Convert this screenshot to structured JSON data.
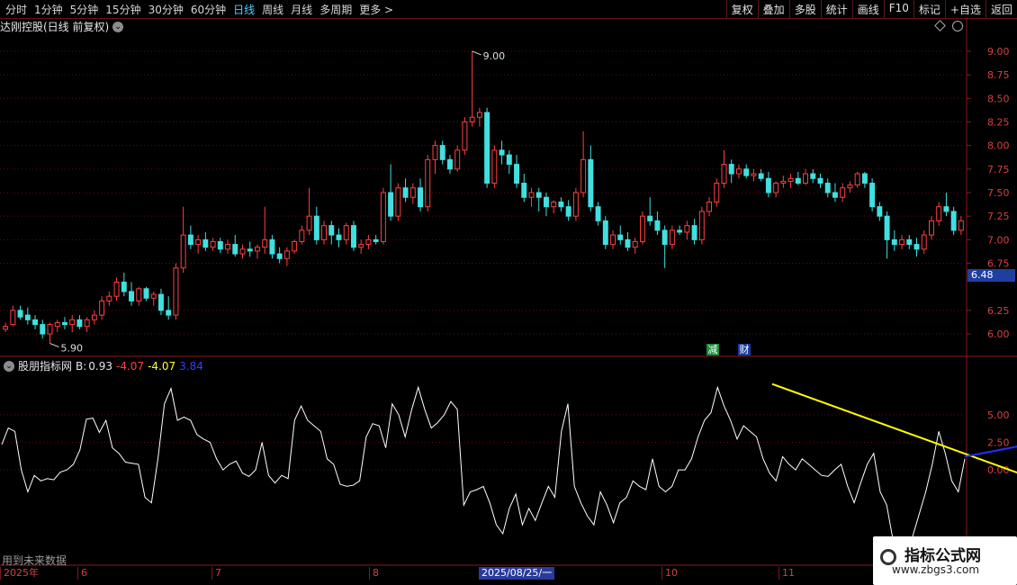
{
  "toolbar": {
    "timeframes": [
      "分时",
      "1分钟",
      "5分钟",
      "15分钟",
      "30分钟",
      "60分钟",
      "日线",
      "周线",
      "月线",
      "多周期",
      "更多 >"
    ],
    "active": "日线",
    "right_buttons": [
      "复权",
      "叠加",
      "多股",
      "统计",
      "画线",
      "F10",
      "标记",
      "+自选",
      "返回"
    ]
  },
  "chart_title": "达刚控股(日线 前复权)",
  "price_axis": [
    "9.00",
    "8.75",
    "8.50",
    "8.25",
    "8.00",
    "7.75",
    "7.50",
    "7.25",
    "7.00",
    "6.75",
    "6.25",
    "6.00"
  ],
  "current_price": "6.48",
  "high_label": "9.00",
  "low_label": "5.90",
  "badges": {
    "reduce": "减",
    "finance": "财"
  },
  "indicator": {
    "name": "股朋指标网",
    "b_label": "B:",
    "b_value": "0.93",
    "v2": "-4.07",
    "v3": "-4.07",
    "v4": "3.84",
    "axis": [
      "5.00",
      "2.50",
      "0.00"
    ]
  },
  "footer_note": "用到未来数据",
  "date_axis": {
    "ticks": [
      "2025年",
      "6",
      "7",
      "8",
      "10",
      "11"
    ],
    "highlight": "2025/08/25/一"
  },
  "logo": {
    "main": "指标公式网",
    "sub": "www.zbgs3.com"
  },
  "colors": {
    "up": "#ff4040",
    "down": "#40e0e0",
    "grid": "#5a1010",
    "line1": "#ffffff",
    "yellow": "#ffff00",
    "blue": "#2030ff"
  },
  "chart_data": {
    "type": "candlestick",
    "ohlc": [
      [
        6.05,
        6.12,
        6.02,
        6.08
      ],
      [
        6.1,
        6.3,
        6.08,
        6.25
      ],
      [
        6.25,
        6.3,
        6.15,
        6.18
      ],
      [
        6.2,
        6.28,
        6.1,
        6.15
      ],
      [
        6.15,
        6.2,
        6.05,
        6.1
      ],
      [
        6.1,
        6.15,
        5.95,
        6.0
      ],
      [
        6.0,
        6.12,
        5.9,
        6.1
      ],
      [
        6.08,
        6.15,
        6.02,
        6.12
      ],
      [
        6.12,
        6.18,
        6.05,
        6.1
      ],
      [
        6.1,
        6.2,
        6.02,
        6.15
      ],
      [
        6.15,
        6.2,
        6.05,
        6.08
      ],
      [
        6.08,
        6.18,
        6.02,
        6.15
      ],
      [
        6.15,
        6.25,
        6.1,
        6.2
      ],
      [
        6.2,
        6.4,
        6.15,
        6.35
      ],
      [
        6.35,
        6.45,
        6.3,
        6.4
      ],
      [
        6.4,
        6.6,
        6.35,
        6.55
      ],
      [
        6.55,
        6.65,
        6.4,
        6.45
      ],
      [
        6.45,
        6.55,
        6.3,
        6.35
      ],
      [
        6.35,
        6.5,
        6.3,
        6.48
      ],
      [
        6.48,
        6.5,
        6.35,
        6.38
      ],
      [
        6.38,
        6.45,
        6.3,
        6.42
      ],
      [
        6.42,
        6.48,
        6.2,
        6.25
      ],
      [
        6.25,
        6.4,
        6.15,
        6.2
      ],
      [
        6.2,
        6.75,
        6.15,
        6.7
      ],
      [
        6.7,
        7.35,
        6.65,
        7.05
      ],
      [
        7.05,
        7.15,
        6.9,
        6.95
      ],
      [
        6.95,
        7.05,
        6.85,
        7.0
      ],
      [
        7.0,
        7.08,
        6.88,
        6.92
      ],
      [
        6.92,
        7.02,
        6.88,
        6.98
      ],
      [
        6.98,
        7.02,
        6.86,
        6.9
      ],
      [
        6.9,
        7.0,
        6.85,
        6.95
      ],
      [
        6.95,
        7.05,
        6.82,
        6.85
      ],
      [
        6.85,
        6.95,
        6.8,
        6.9
      ],
      [
        6.9,
        6.98,
        6.82,
        6.88
      ],
      [
        6.88,
        6.95,
        6.8,
        6.92
      ],
      [
        6.92,
        7.35,
        6.85,
        7.0
      ],
      [
        7.0,
        7.05,
        6.8,
        6.85
      ],
      [
        6.85,
        6.92,
        6.75,
        6.8
      ],
      [
        6.8,
        6.92,
        6.72,
        6.88
      ],
      [
        6.88,
        7.0,
        6.85,
        6.98
      ],
      [
        6.98,
        7.15,
        6.95,
        7.1
      ],
      [
        7.1,
        7.55,
        7.05,
        7.25
      ],
      [
        7.25,
        7.35,
        6.95,
        7.0
      ],
      [
        7.0,
        7.2,
        6.95,
        7.15
      ],
      [
        7.15,
        7.2,
        6.95,
        7.05
      ],
      [
        7.05,
        7.12,
        6.92,
        7.0
      ],
      [
        7.0,
        7.18,
        6.95,
        7.15
      ],
      [
        7.15,
        7.2,
        6.88,
        6.92
      ],
      [
        6.92,
        7.0,
        6.85,
        6.95
      ],
      [
        6.95,
        7.05,
        6.9,
        7.0
      ],
      [
        7.0,
        7.05,
        6.95,
        6.98
      ],
      [
        6.98,
        7.55,
        6.95,
        7.5
      ],
      [
        7.5,
        7.8,
        7.2,
        7.25
      ],
      [
        7.25,
        7.6,
        7.2,
        7.55
      ],
      [
        7.55,
        7.65,
        7.4,
        7.45
      ],
      [
        7.45,
        7.6,
        7.38,
        7.55
      ],
      [
        7.55,
        7.65,
        7.3,
        7.35
      ],
      [
        7.35,
        7.9,
        7.3,
        7.85
      ],
      [
        7.85,
        8.05,
        7.7,
        8.0
      ],
      [
        8.0,
        8.05,
        7.8,
        7.85
      ],
      [
        7.85,
        7.9,
        7.7,
        7.75
      ],
      [
        7.75,
        8.0,
        7.72,
        7.95
      ],
      [
        7.95,
        8.3,
        7.9,
        8.25
      ],
      [
        8.25,
        9.0,
        8.2,
        8.3
      ],
      [
        8.3,
        8.4,
        8.2,
        8.35
      ],
      [
        8.35,
        8.4,
        7.55,
        7.6
      ],
      [
        7.6,
        8.0,
        7.55,
        7.95
      ],
      [
        7.95,
        8.05,
        7.8,
        7.9
      ],
      [
        7.9,
        7.95,
        7.7,
        7.8
      ],
      [
        7.8,
        7.9,
        7.55,
        7.6
      ],
      [
        7.6,
        7.7,
        7.4,
        7.45
      ],
      [
        7.45,
        7.55,
        7.35,
        7.5
      ],
      [
        7.5,
        7.55,
        7.3,
        7.45
      ],
      [
        7.45,
        7.5,
        7.25,
        7.35
      ],
      [
        7.35,
        7.42,
        7.28,
        7.4
      ],
      [
        7.4,
        7.45,
        7.3,
        7.35
      ],
      [
        7.35,
        7.42,
        7.2,
        7.25
      ],
      [
        7.25,
        7.55,
        7.2,
        7.5
      ],
      [
        7.5,
        8.15,
        7.45,
        7.85
      ],
      [
        7.85,
        8.0,
        7.3,
        7.35
      ],
      [
        7.35,
        7.4,
        7.15,
        7.2
      ],
      [
        7.2,
        7.25,
        6.9,
        6.95
      ],
      [
        6.95,
        7.1,
        6.9,
        7.05
      ],
      [
        7.05,
        7.15,
        6.95,
        7.0
      ],
      [
        7.0,
        7.08,
        6.88,
        6.92
      ],
      [
        6.92,
        7.02,
        6.85,
        6.98
      ],
      [
        6.98,
        7.3,
        6.95,
        7.25
      ],
      [
        7.25,
        7.45,
        7.15,
        7.2
      ],
      [
        7.2,
        7.3,
        7.05,
        7.1
      ],
      [
        7.1,
        7.15,
        6.7,
        6.95
      ],
      [
        6.95,
        7.15,
        6.9,
        7.1
      ],
      [
        7.1,
        7.15,
        7.05,
        7.08
      ],
      [
        7.08,
        7.2,
        7.0,
        7.15
      ],
      [
        7.15,
        7.22,
        6.95,
        7.0
      ],
      [
        7.0,
        7.35,
        6.95,
        7.3
      ],
      [
        7.3,
        7.45,
        7.25,
        7.4
      ],
      [
        7.4,
        7.65,
        7.35,
        7.6
      ],
      [
        7.6,
        7.95,
        7.55,
        7.8
      ],
      [
        7.8,
        7.85,
        7.6,
        7.7
      ],
      [
        7.7,
        7.8,
        7.65,
        7.75
      ],
      [
        7.75,
        7.8,
        7.65,
        7.68
      ],
      [
        7.68,
        7.75,
        7.62,
        7.7
      ],
      [
        7.7,
        7.75,
        7.62,
        7.65
      ],
      [
        7.65,
        7.72,
        7.45,
        7.5
      ],
      [
        7.5,
        7.62,
        7.45,
        7.6
      ],
      [
        7.6,
        7.68,
        7.55,
        7.62
      ],
      [
        7.62,
        7.7,
        7.55,
        7.65
      ],
      [
        7.65,
        7.72,
        7.58,
        7.6
      ],
      [
        7.6,
        7.75,
        7.58,
        7.7
      ],
      [
        7.7,
        7.75,
        7.6,
        7.65
      ],
      [
        7.65,
        7.7,
        7.55,
        7.6
      ],
      [
        7.6,
        7.65,
        7.45,
        7.5
      ],
      [
        7.5,
        7.6,
        7.4,
        7.45
      ],
      [
        7.45,
        7.6,
        7.4,
        7.55
      ],
      [
        7.55,
        7.62,
        7.5,
        7.58
      ],
      [
        7.58,
        7.72,
        7.55,
        7.7
      ],
      [
        7.7,
        7.72,
        7.55,
        7.6
      ],
      [
        7.6,
        7.65,
        7.3,
        7.35
      ],
      [
        7.35,
        7.4,
        7.2,
        7.25
      ],
      [
        7.25,
        7.3,
        6.8,
        7.0
      ],
      [
        7.0,
        7.1,
        6.88,
        6.95
      ],
      [
        6.95,
        7.05,
        6.9,
        7.0
      ],
      [
        7.0,
        7.05,
        6.9,
        6.95
      ],
      [
        6.95,
        7.02,
        6.82,
        6.9
      ],
      [
        6.9,
        7.1,
        6.85,
        7.05
      ],
      [
        7.05,
        7.25,
        7.0,
        7.2
      ],
      [
        7.2,
        7.4,
        7.15,
        7.35
      ],
      [
        7.35,
        7.5,
        7.25,
        7.3
      ],
      [
        7.3,
        7.35,
        7.05,
        7.1
      ],
      [
        7.1,
        7.25,
        7.05,
        7.2
      ]
    ],
    "indicator_line": [
      2.3,
      3.8,
      3.5,
      0.0,
      -2.0,
      -0.5,
      -1.0,
      -0.8,
      -0.9,
      -0.2,
      0.0,
      0.5,
      1.8,
      4.6,
      4.7,
      3.4,
      4.5,
      2.0,
      1.5,
      0.7,
      0.6,
      0.5,
      -2.5,
      -3.0,
      1.0,
      6.0,
      7.4,
      4.5,
      4.8,
      4.5,
      3.2,
      2.8,
      2.5,
      1.0,
      0.0,
      0.5,
      0.8,
      -0.3,
      -0.6,
      0.0,
      2.5,
      -0.5,
      -1.2,
      -0.5,
      -0.8,
      4.5,
      5.8,
      4.5,
      4.0,
      3.5,
      1.0,
      0.5,
      -1.3,
      -1.5,
      -1.4,
      -1.0,
      3.0,
      4.2,
      4.0,
      2.0,
      6.0,
      5.0,
      3.0,
      5.5,
      7.5,
      5.5,
      3.8,
      4.3,
      5.0,
      6.2,
      5.5,
      -3.2,
      -2.0,
      -1.8,
      -1.5,
      -3.0,
      -5.0,
      -5.8,
      -3.5,
      -2.2,
      -5.0,
      -3.5,
      -4.6,
      -3.0,
      -1.5,
      -2.5,
      3.5,
      6.0,
      -1.5,
      -3.0,
      -4.2,
      -5.0,
      -2.0,
      -3.2,
      -4.8,
      -3.0,
      -2.5,
      -1.0,
      -1.5,
      -1.8,
      1.0,
      -1.5,
      -2.0,
      -1.5,
      0.0,
      0.0,
      1.0,
      3.0,
      4.5,
      5.2,
      7.5,
      5.8,
      4.5,
      2.8,
      4.0,
      3.5,
      3.0,
      1.0,
      -0.3,
      -1.0,
      1.2,
      0.5,
      0.0,
      1.0,
      0.5,
      0.0,
      -0.5,
      -0.6,
      0.0,
      0.5,
      -1.5,
      -3.0,
      -1.2,
      0.5,
      1.5,
      -2.0,
      -3.2,
      -6.5,
      -7.5,
      -8.0,
      -6.0,
      -4.0,
      -2.0,
      0.5,
      3.5,
      1.5,
      -1.0,
      -2.0,
      1.0
    ],
    "indicator_range": [
      -8.5,
      9.0
    ],
    "price_range": [
      5.8,
      9.2
    ],
    "yellow_line": {
      "from_index": 104,
      "from_value": 7.8,
      "to_index": 150,
      "to_value": -3.4
    },
    "blue_line": {
      "from_index": 130,
      "from_value": 1.2,
      "to_index": 150,
      "to_value": 3.8
    }
  }
}
